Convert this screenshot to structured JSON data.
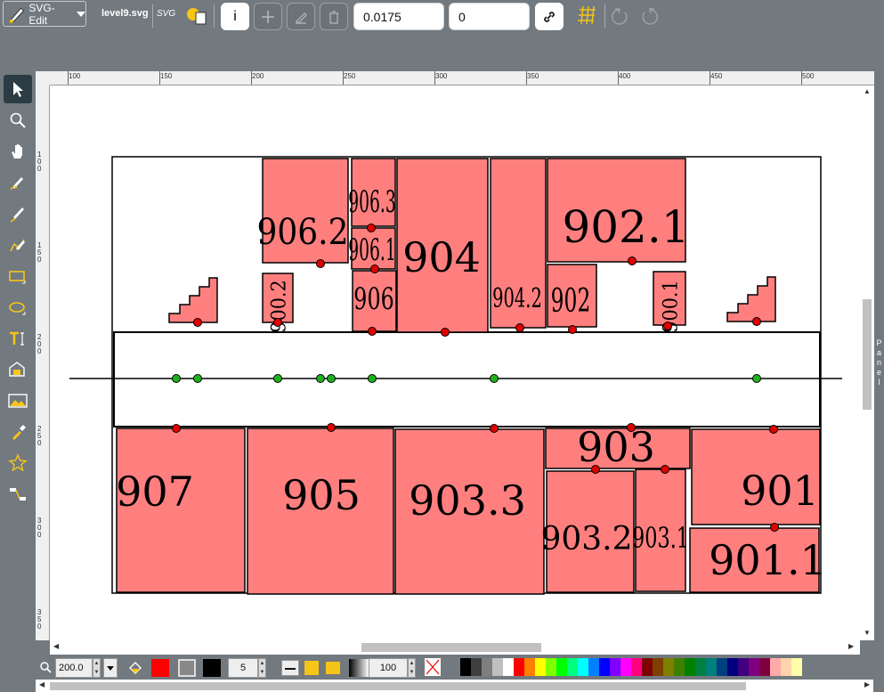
{
  "app": {
    "name": "SVG-Edit",
    "file": "level9.svg",
    "svg_badge": "SVG"
  },
  "toolbar": {
    "info_label": "i",
    "stroke_width_value": "0.0175",
    "second_value": "0"
  },
  "tools": [
    "select-tool",
    "zoom-tool",
    "pan-tool",
    "pencil-tool",
    "line-tool",
    "path-tool",
    "rect-tool",
    "ellipse-tool",
    "text-tool",
    "shapelib-tool",
    "image-tool",
    "eyedropper-tool",
    "star-tool",
    "connector-tool"
  ],
  "ruler": {
    "top_labels": [
      "100",
      "150",
      "200",
      "250",
      "300",
      "350",
      "400",
      "450",
      "500"
    ],
    "left_labels": [
      "100",
      "150",
      "200",
      "250",
      "300",
      "350"
    ]
  },
  "side_panel_label": [
    "P",
    "a",
    "n",
    "e",
    "l"
  ],
  "bottombar": {
    "zoom": "200.0",
    "stroke_width": "5",
    "opacity": "100",
    "fill_color": "#ff0000",
    "stroke_color": "#000000"
  },
  "palette": [
    "#000000",
    "#3f3f3f",
    "#7f7f7f",
    "#bfbfbf",
    "#ffffff",
    "#ff0000",
    "#ff7f00",
    "#ffff00",
    "#7fff00",
    "#00ff00",
    "#00ff7f",
    "#00ffff",
    "#007fff",
    "#0000ff",
    "#7f00ff",
    "#ff00ff",
    "#ff007f",
    "#7f0000",
    "#7f3f00",
    "#7f7f00",
    "#3f7f00",
    "#007f00",
    "#007f3f",
    "#007f7f",
    "#003f7f",
    "#00007f",
    "#3f007f",
    "#7f007f",
    "#7f003f",
    "#ffaaaa",
    "#ffd4aa",
    "#ffffaa"
  ],
  "drawing": {
    "fill": "#ff7f7f",
    "rooms": [
      {
        "label": "906.2"
      },
      {
        "label": "906.3"
      },
      {
        "label": "906.1"
      },
      {
        "label": "906"
      },
      {
        "label": "904"
      },
      {
        "label": "904.2"
      },
      {
        "label": "902.1"
      },
      {
        "label": "902"
      },
      {
        "label": "900.2"
      },
      {
        "label": "900.1"
      },
      {
        "label": "907"
      },
      {
        "label": "905"
      },
      {
        "label": "903.3"
      },
      {
        "label": "903"
      },
      {
        "label": "903.2"
      },
      {
        "label": "903.1"
      },
      {
        "label": "901"
      },
      {
        "label": "901.1"
      }
    ]
  }
}
